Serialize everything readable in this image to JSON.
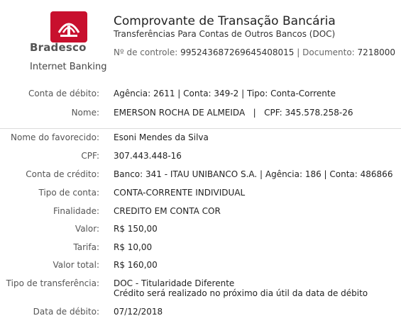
{
  "brand": {
    "name": "Bradesco",
    "subtitle": "Internet Banking",
    "color": "#c8102e"
  },
  "header": {
    "title": "Comprovante de Transação Bancária",
    "subtitle": "Transferências Para Contas de Outros Bancos (DOC)",
    "control_label": "Nº de controle:",
    "control_value": "995243687269645408015",
    "document_label": "Documento:",
    "document_value": "7218000"
  },
  "debit_section": [
    {
      "label": "Conta de débito:",
      "value": "Agência: 2611 | Conta: 349-2 | Tipo: Conta-Corrente"
    },
    {
      "label": "Nome:",
      "value": "EMERSON ROCHA DE ALMEIDA   |   CPF: 345.578.258-26"
    }
  ],
  "details": [
    {
      "label": "Nome do favorecido:",
      "value": "Esoni Mendes da Silva"
    },
    {
      "label": "CPF:",
      "value": "307.443.448-16"
    },
    {
      "label": "Conta de crédito:",
      "value": "Banco: 341 - ITAU UNIBANCO S.A. | Agência: 186 | Conta: 486866"
    },
    {
      "label": "Tipo de conta:",
      "value": "CONTA-CORRENTE INDIVIDUAL"
    },
    {
      "label": "Finalidade:",
      "value": "CREDITO EM CONTA COR"
    },
    {
      "label": "Valor:",
      "value": "R$ 150,00"
    },
    {
      "label": "Tarifa:",
      "value": "R$ 10,00"
    },
    {
      "label": "Valor total:",
      "value": "R$ 160,00"
    },
    {
      "label": "Tipo de transferência:",
      "value": "DOC - Titularidade Diferente",
      "value2": "Crédito será realizado no próximo dia útil da data de débito"
    },
    {
      "label": "Data de débito:",
      "value": "07/12/2018"
    }
  ]
}
